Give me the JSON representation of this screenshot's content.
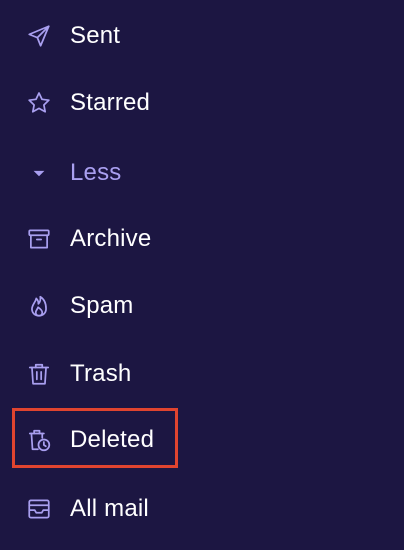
{
  "folders": {
    "sent": "Sent",
    "starred": "Starred",
    "less": "Less",
    "archive": "Archive",
    "spam": "Spam",
    "trash": "Trash",
    "deleted": "Deleted",
    "all_mail": "All mail"
  },
  "icons": {
    "sent": "send-icon",
    "starred": "star-icon",
    "less": "caret-down-icon",
    "archive": "archive-icon",
    "spam": "fire-icon",
    "trash": "trash-icon",
    "deleted": "deleted-clock-icon",
    "all_mail": "inbox-stack-icon"
  },
  "colors": {
    "background": "#1c1642",
    "icon": "#a99ff0",
    "text": "#ffffff",
    "highlight": "#e0442f"
  }
}
